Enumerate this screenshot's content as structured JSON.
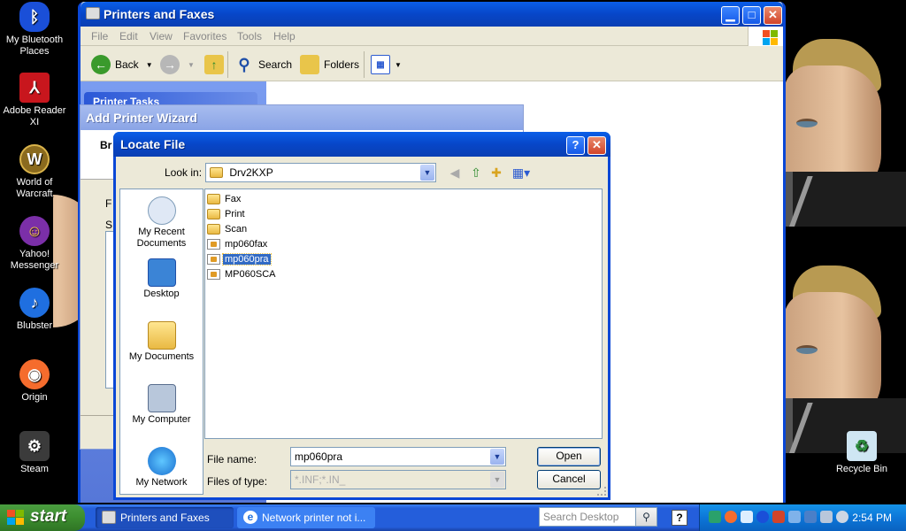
{
  "desktop": {
    "icons": [
      {
        "label": "My Bluetooth Places",
        "icon": "bluetooth-icon",
        "color": "#1a4fd8"
      },
      {
        "label": "Adobe Reader XI",
        "icon": "adobe-reader-icon",
        "color": "#c8161d"
      },
      {
        "label": "World of Warcraft",
        "icon": "warcraft-icon",
        "color": "#8a6a1e"
      },
      {
        "label": "Yahoo! Messenger",
        "icon": "yahoo-messenger-icon",
        "color": "#7b2fa8"
      },
      {
        "label": "Blubster",
        "icon": "blubster-icon",
        "color": "#1f6fe0"
      },
      {
        "label": "Origin",
        "icon": "origin-icon",
        "color": "#f56c2d"
      },
      {
        "label": "Steam",
        "icon": "steam-icon",
        "color": "#3b3b3b"
      }
    ],
    "recycle_bin": "Recycle Bin"
  },
  "printers_window": {
    "title": "Printers and Faxes",
    "menu": [
      "File",
      "Edit",
      "View",
      "Favorites",
      "Tools",
      "Help"
    ],
    "toolbar": {
      "back": "Back",
      "search": "Search",
      "folders": "Folders"
    },
    "tasks_header": "Printer Tasks"
  },
  "wizard": {
    "title": "Add Printer Wizard",
    "header_fragment": "Br",
    "frag_f": "F",
    "frag_s": "S"
  },
  "locate_dialog": {
    "title": "Locate File",
    "look_in_label": "Look in:",
    "look_in_value": "Drv2KXP",
    "places": [
      "My Recent Documents",
      "Desktop",
      "My Documents",
      "My Computer",
      "My Network"
    ],
    "files": [
      {
        "name": "Fax",
        "type": "folder"
      },
      {
        "name": "Print",
        "type": "folder"
      },
      {
        "name": "Scan",
        "type": "folder"
      },
      {
        "name": "mp060fax",
        "type": "inf"
      },
      {
        "name": "mp060pra",
        "type": "inf",
        "selected": true
      },
      {
        "name": "MP060SCA",
        "type": "inf"
      }
    ],
    "file_name_label": "File name:",
    "file_name_value": "mp060pra",
    "files_of_type_label": "Files of type:",
    "files_of_type_value": "*.INF;*.IN_",
    "open_button": "Open",
    "cancel_button": "Cancel"
  },
  "taskbar": {
    "start": "start",
    "tasks": [
      {
        "label": "Printers and Faxes",
        "active": true
      },
      {
        "label": "Network printer not i...",
        "active": false
      }
    ],
    "search_placeholder": "Search Desktop",
    "help": "?",
    "clock": "2:54 PM"
  },
  "colors": {
    "xp_blue": "#0a47d6",
    "taskbar_blue": "#245edb",
    "start_green": "#3c8d2f",
    "selection": "#316ac5"
  }
}
